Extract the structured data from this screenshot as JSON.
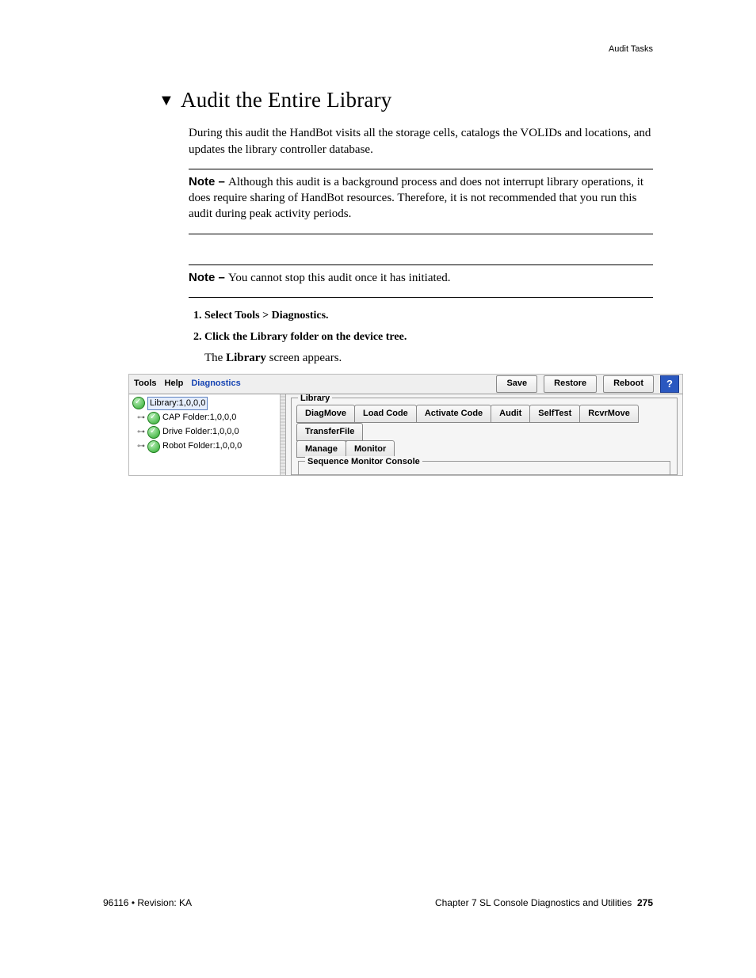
{
  "header": {
    "right": "Audit Tasks"
  },
  "section": {
    "title": "Audit the Entire Library",
    "intro": "During this audit the HandBot visits all the storage cells, catalogs the VOLIDs and locations, and updates the library controller database.",
    "note1_label": "Note – ",
    "note1_text": "Although this audit is a background process and does not interrupt library operations, it does require sharing of HandBot resources. Therefore, it is not recommended that you run this audit during peak activity periods.",
    "note2_label": "Note – ",
    "note2_text": "You cannot stop this audit once it has initiated.",
    "steps": [
      {
        "text": "Select Tools > Diagnostics.",
        "sub": ""
      },
      {
        "text": "Click the Library folder on the device tree.",
        "sub_pre": "The ",
        "sub_bold": "Library",
        "sub_post": " screen appears."
      }
    ]
  },
  "ui": {
    "menu": {
      "tools": "Tools",
      "help": "Help",
      "diagnostics": "Diagnostics"
    },
    "buttons": {
      "save": "Save",
      "restore": "Restore",
      "reboot": "Reboot"
    },
    "help_icon": "?",
    "tree": {
      "root": "Library:1,0,0,0",
      "children": [
        "CAP Folder:1,0,0,0",
        "Drive Folder:1,0,0,0",
        "Robot Folder:1,0,0,0"
      ]
    },
    "panel": {
      "legend": "Library",
      "tabs_row1": [
        "DiagMove",
        "Load Code",
        "Activate Code",
        "Audit",
        "SelfTest",
        "RcvrMove",
        "TransferFile"
      ],
      "tabs_row2": [
        "Manage",
        "Monitor"
      ],
      "inner_legend": "Sequence Monitor Console"
    }
  },
  "footer": {
    "left": "96116 • Revision: KA",
    "chapter": "Chapter 7 SL Console Diagnostics and Utilities",
    "page": "275"
  }
}
